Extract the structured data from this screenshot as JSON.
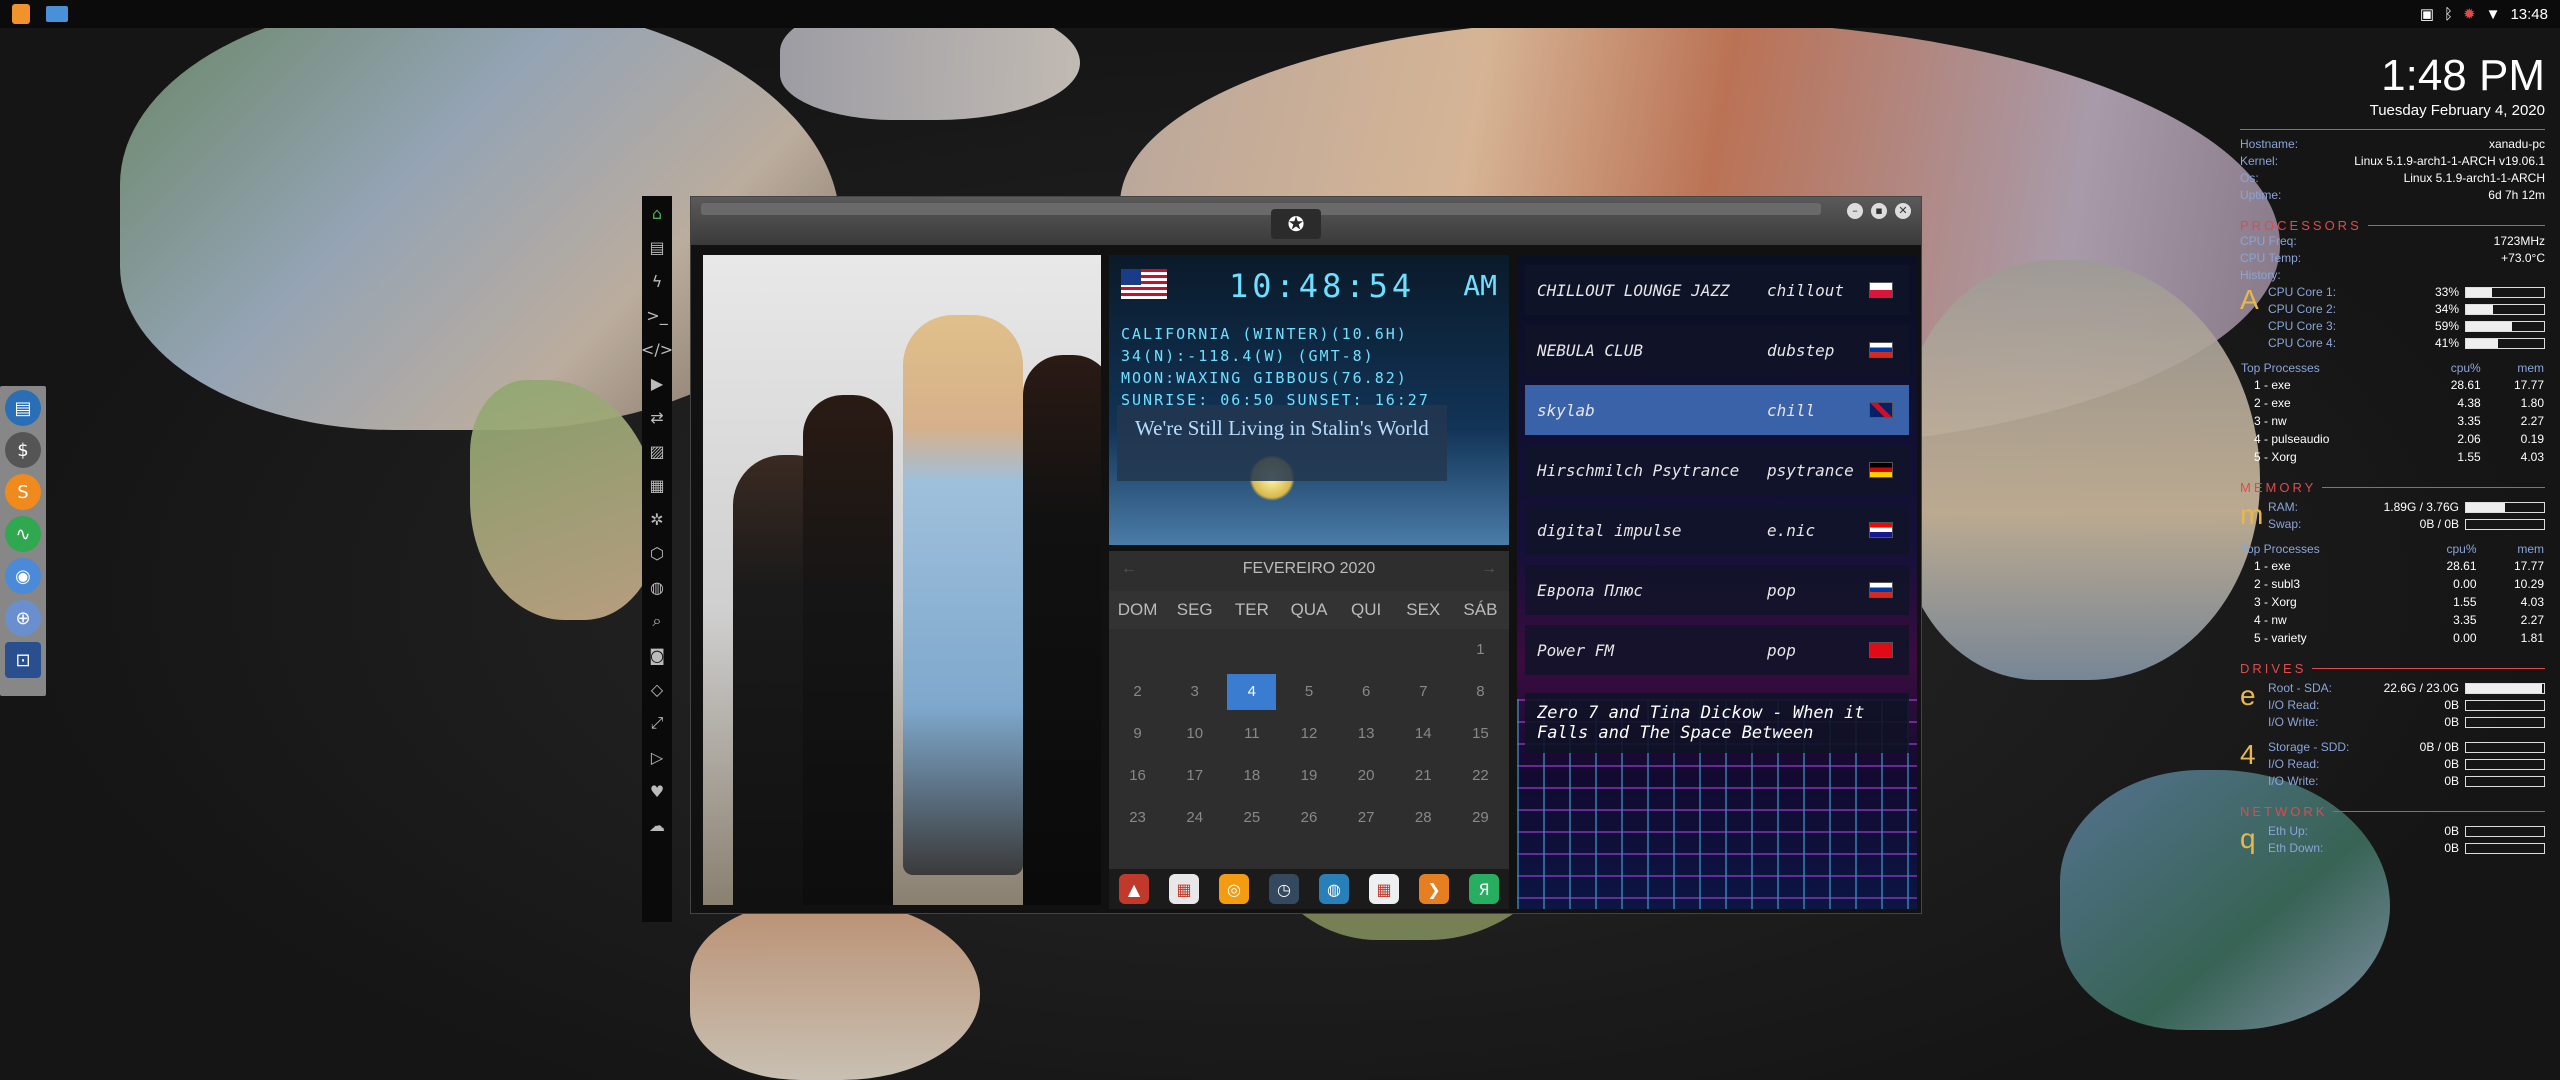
{
  "top_panel": {
    "launchers": [
      "sublime-text-icon",
      "folder-icon"
    ],
    "tray_icons": [
      "photo-icon",
      "bluetooth-icon",
      "alert-icon",
      "wifi-icon"
    ],
    "time": "13:48"
  },
  "left_dock": {
    "icons": [
      "drive-icon",
      "terminal-icon",
      "skype-icon",
      "monitor-icon",
      "chrome-icon",
      "network-icon",
      "screenshot-icon"
    ]
  },
  "desktop_clock": {
    "time": "1:48 PM",
    "date": "Tuesday February  4, 2020"
  },
  "conky": {
    "system": [
      {
        "key": "Hostname:",
        "value": "xanadu-pc"
      },
      {
        "key": "Kernel:",
        "value": "Linux 5.1.9-arch1-1-ARCH v19.06.1"
      },
      {
        "key": "Os:",
        "value": "Linux 5.1.9-arch1-1-ARCH"
      },
      {
        "key": "Uptime:",
        "value": "6d 7h 12m"
      }
    ],
    "processors_title": "PROCESSORS",
    "processors_letter": "A",
    "cpu_info": [
      {
        "key": "CPU Freq:",
        "value": "1723MHz"
      },
      {
        "key": "CPU Temp:",
        "value": "+73.0°C"
      },
      {
        "key": "History:",
        "value": ""
      }
    ],
    "cpu_cores": [
      {
        "key": "CPU Core 1:",
        "value": "33%",
        "level": 0.33
      },
      {
        "key": "CPU Core 2:",
        "value": "34%",
        "level": 0.34
      },
      {
        "key": "CPU Core 3:",
        "value": "59%",
        "level": 0.59
      },
      {
        "key": "CPU Core 4:",
        "value": "41%",
        "level": 0.41
      }
    ],
    "top_processes_label": "Top Processes",
    "cpu_col": "cpu%",
    "mem_col": "mem",
    "top_cpu": [
      {
        "name": "1 - exe",
        "cpu": "28.61",
        "mem": "17.77"
      },
      {
        "name": "2 - exe",
        "cpu": "4.38",
        "mem": "1.80"
      },
      {
        "name": "3 - nw",
        "cpu": "3.35",
        "mem": "2.27"
      },
      {
        "name": "4 - pulseaudio",
        "cpu": "2.06",
        "mem": "0.19"
      },
      {
        "name": "5 - Xorg",
        "cpu": "1.55",
        "mem": "4.03"
      }
    ],
    "memory_title": "MEMORY",
    "memory_letter": "m",
    "memory": [
      {
        "key": "RAM:",
        "value": "1.89G / 3.76G",
        "level": 0.5
      },
      {
        "key": "Swap:",
        "value": "0B / 0B",
        "level": 0
      }
    ],
    "top_mem": [
      {
        "name": "1 - exe",
        "cpu": "28.61",
        "mem": "17.77"
      },
      {
        "name": "2 - subl3",
        "cpu": "0.00",
        "mem": "10.29"
      },
      {
        "name": "3 - Xorg",
        "cpu": "1.55",
        "mem": "4.03"
      },
      {
        "name": "4 - nw",
        "cpu": "3.35",
        "mem": "2.27"
      },
      {
        "name": "5 - variety",
        "cpu": "0.00",
        "mem": "1.81"
      }
    ],
    "drives_title": "DRIVES",
    "drives_letter": "e",
    "drive_root": [
      {
        "key": "Root - SDA:",
        "value": "22.6G / 23.0G",
        "level": 0.98
      },
      {
        "key": "I/O Read:",
        "value": "0B",
        "level": 0
      },
      {
        "key": "I/O Write:",
        "value": "0B",
        "level": 0
      }
    ],
    "storage_letter": "4",
    "drive_storage": [
      {
        "key": "Storage - SDD:",
        "value": "0B / 0B",
        "level": 0
      },
      {
        "key": "I/O Read:",
        "value": "0B",
        "level": 0
      },
      {
        "key": "I/O Write:",
        "value": "0B",
        "level": 0
      }
    ],
    "network_title": "NETWORK",
    "network_letter": "q",
    "network": [
      {
        "key": "Eth Up:",
        "value": "0B",
        "level": 0
      },
      {
        "key": "Eth Down:",
        "value": "0B",
        "level": 0
      }
    ]
  },
  "app_window": {
    "logo": "rebel-alliance-icon",
    "side_launcher": [
      "home-icon",
      "document-icon",
      "lightning-icon",
      "terminal-icon",
      "code-icon",
      "play-icon",
      "translate-icon",
      "image-icon",
      "news-icon",
      "settings-icon",
      "hexagon-icon",
      "globe-icon",
      "search-icon",
      "contact-icon",
      "tag-icon",
      "expand-icon",
      "youtube-icon",
      "heart-icon",
      "cloud-icon"
    ],
    "world_clock": {
      "time": "10:48:54",
      "ampm": "AM",
      "lines": [
        "CALIFORNIA (WINTER)(10.6H)",
        "34(N):-118.4(W) (GMT-8)",
        "MOON:WAXING GIBBOUS(76.82)",
        "SUNRISE: 06:50 SUNSET: 16:27"
      ],
      "song_title": "We're Still Living in Stalin's World"
    },
    "calendar": {
      "month": "FEVEREIRO 2020",
      "weekdays": [
        "DOM",
        "SEG",
        "TER",
        "QUA",
        "QUI",
        "SEX",
        "SÁB"
      ],
      "days": [
        "",
        "",
        "",
        "",
        "",
        "",
        "1",
        "2",
        "3",
        "4",
        "5",
        "6",
        "7",
        "8",
        "9",
        "10",
        "11",
        "12",
        "13",
        "14",
        "15",
        "16",
        "17",
        "18",
        "19",
        "20",
        "21",
        "22",
        "23",
        "24",
        "25",
        "26",
        "27",
        "28",
        "29"
      ],
      "today": "4"
    },
    "app_dock": [
      "app-a-icon",
      "calendar-app-icon",
      "search-app-icon",
      "clock-app-icon",
      "globe-app-icon",
      "calendar-date-icon",
      "arrow-app-icon",
      "yandex-icon"
    ],
    "radio": {
      "stations": [
        {
          "name": "CHILLOUT LOUNGE JAZZ",
          "genre": "chillout",
          "flag": "poland"
        },
        {
          "name": "NEBULA CLUB",
          "genre": "dubstep",
          "flag": "russia"
        },
        {
          "name": "skylab",
          "genre": "chill",
          "flag": "uk"
        },
        {
          "name": "Hirschmilch Psytrance",
          "genre": "psytrance",
          "flag": "germany"
        },
        {
          "name": "digital impulse",
          "genre": "e.nic",
          "flag": "croatia"
        },
        {
          "name": "Европа Плюс",
          "genre": "pop",
          "flag": "russia"
        },
        {
          "name": "Power FM",
          "genre": "pop",
          "flag": "turkey"
        }
      ],
      "selected_index": 2,
      "now_playing": "Zero 7 and Tina Dickow - When it Falls and The Space Between"
    }
  },
  "colors": {
    "accent_red": "#e04a4a",
    "conky_key": "#8aa4d8",
    "conky_letter": "#e7b84b",
    "calendar_today": "#3a7dd0",
    "radio_selected": "#3a62a8",
    "digital_cyan": "#6ee0ff"
  }
}
